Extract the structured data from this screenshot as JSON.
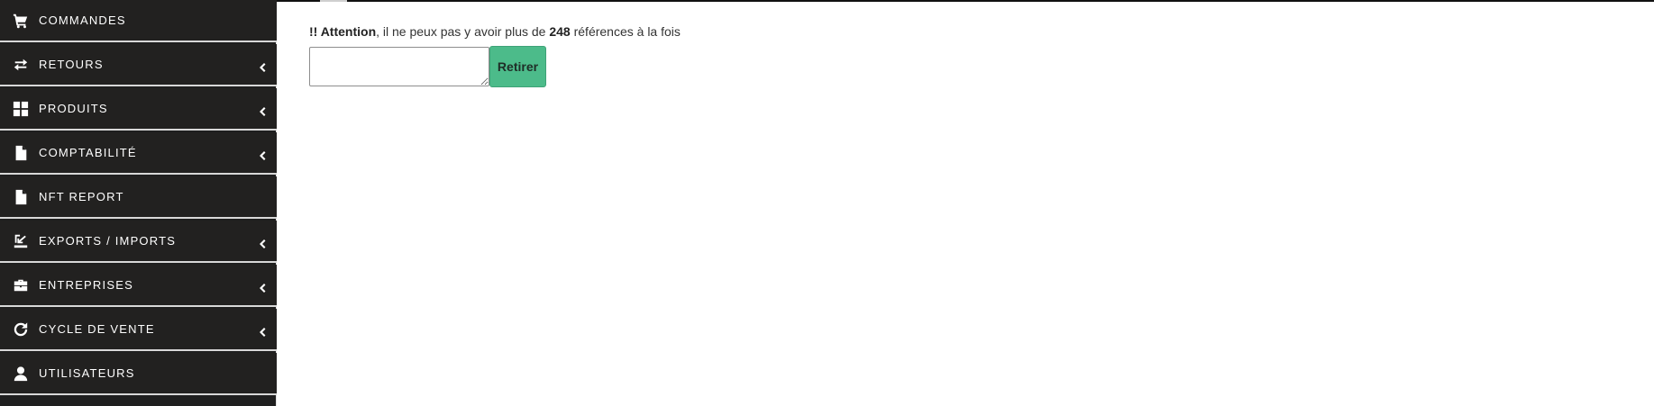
{
  "sidebar": {
    "items": [
      {
        "label": "Commandes",
        "icon": "cart-icon",
        "has_submenu": false
      },
      {
        "label": "Retours",
        "icon": "exchange-icon",
        "has_submenu": true
      },
      {
        "label": "Produits",
        "icon": "grid-icon",
        "has_submenu": true
      },
      {
        "label": "Comptabilité",
        "icon": "file-icon",
        "has_submenu": true
      },
      {
        "label": "NFT Report",
        "icon": "file-icon",
        "has_submenu": false
      },
      {
        "label": "Exports / Imports",
        "icon": "export-icon",
        "has_submenu": true
      },
      {
        "label": "Entreprises",
        "icon": "briefcase-icon",
        "has_submenu": true
      },
      {
        "label": "Cycle de vente",
        "icon": "refresh-icon",
        "has_submenu": true
      },
      {
        "label": "Utilisateurs",
        "icon": "user-icon",
        "has_submenu": false
      }
    ]
  },
  "main": {
    "warning": {
      "prefix": "!! Attention",
      "middle": ", il ne peux pas y avoir plus de ",
      "count": "248",
      "suffix": " références à la fois"
    },
    "input": {
      "value": "",
      "placeholder": ""
    },
    "retirer_label": "Retirer"
  },
  "colors": {
    "sidebar_bg": "#222120",
    "sidebar_text": "#ffffff",
    "button_green": "#4cbb8a"
  }
}
